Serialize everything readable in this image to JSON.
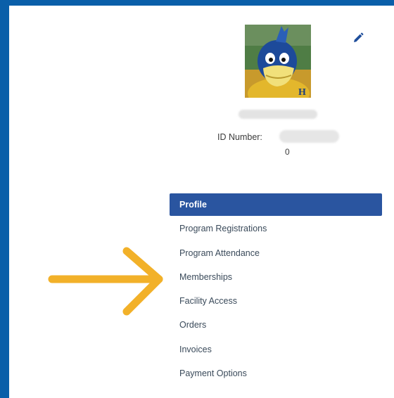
{
  "profile": {
    "id_label": "ID Number:",
    "id_value": "0"
  },
  "menu": {
    "items": [
      {
        "label": "Profile",
        "active": true
      },
      {
        "label": "Program Registrations",
        "active": false
      },
      {
        "label": "Program Attendance",
        "active": false
      },
      {
        "label": "Memberships",
        "active": false
      },
      {
        "label": "Facility Access",
        "active": false
      },
      {
        "label": "Orders",
        "active": false
      },
      {
        "label": "Invoices",
        "active": false
      },
      {
        "label": "Payment Options",
        "active": false
      }
    ]
  },
  "icons": {
    "edit": "pencil-icon",
    "annotation": "arrow-right-icon"
  },
  "colors": {
    "frame": "#0a5fa9",
    "active_item": "#2a55a0",
    "arrow": "#f2b129",
    "edit_icon": "#1f4e9b"
  }
}
